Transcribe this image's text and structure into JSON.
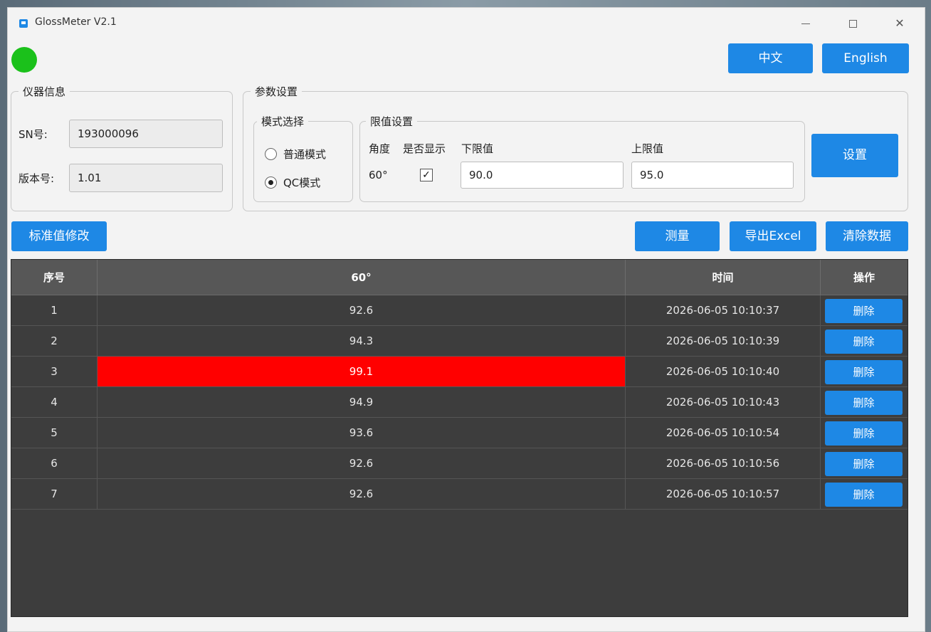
{
  "window": {
    "title": "GlossMeter V2.1",
    "controls": {
      "minimize": "minimize",
      "maximize": "maximize",
      "close": "✕"
    }
  },
  "status": {
    "connected": true,
    "color": "#1bc11b"
  },
  "language": {
    "zh_label": "中文",
    "en_label": "English"
  },
  "device_info": {
    "title": "仪器信息",
    "sn_label": "SN号:",
    "sn_value": "193000096",
    "version_label": "版本号:",
    "version_value": "1.01"
  },
  "params": {
    "title": "参数设置",
    "mode": {
      "title": "模式选择",
      "options": [
        {
          "label": "普通模式",
          "selected": false
        },
        {
          "label": "QC模式",
          "selected": true
        }
      ]
    },
    "limits": {
      "title": "限值设置",
      "angle_header": "角度",
      "display_header": "是否显示",
      "low_header": "下限值",
      "high_header": "上限值",
      "angle": "60°",
      "display_checked": true,
      "checkmark": "✓",
      "low_value": "90.0",
      "high_value": "95.0"
    },
    "set_label": "设置"
  },
  "toolbar": {
    "std_label": "标准值修改",
    "measure_label": "测量",
    "export_label": "导出Excel",
    "clear_label": "清除数据"
  },
  "table": {
    "headers": [
      "序号",
      "60°",
      "时间",
      "操作"
    ],
    "delete_label": "删除",
    "rows": [
      {
        "index": "1",
        "value": "92.6",
        "time": "2026-06-05 10:10:37",
        "out_of_range": false
      },
      {
        "index": "2",
        "value": "94.3",
        "time": "2026-06-05 10:10:39",
        "out_of_range": false
      },
      {
        "index": "3",
        "value": "99.1",
        "time": "2026-06-05 10:10:40",
        "out_of_range": true
      },
      {
        "index": "4",
        "value": "94.9",
        "time": "2026-06-05 10:10:43",
        "out_of_range": false
      },
      {
        "index": "5",
        "value": "93.6",
        "time": "2026-06-05 10:10:54",
        "out_of_range": false
      },
      {
        "index": "6",
        "value": "92.6",
        "time": "2026-06-05 10:10:56",
        "out_of_range": false
      },
      {
        "index": "7",
        "value": "92.6",
        "time": "2026-06-05 10:10:57",
        "out_of_range": false
      }
    ]
  },
  "colors": {
    "accent": "#1e88e5",
    "alert": "#ff0000",
    "grid_bg": "#3d3d3d",
    "grid_header": "#575757"
  }
}
